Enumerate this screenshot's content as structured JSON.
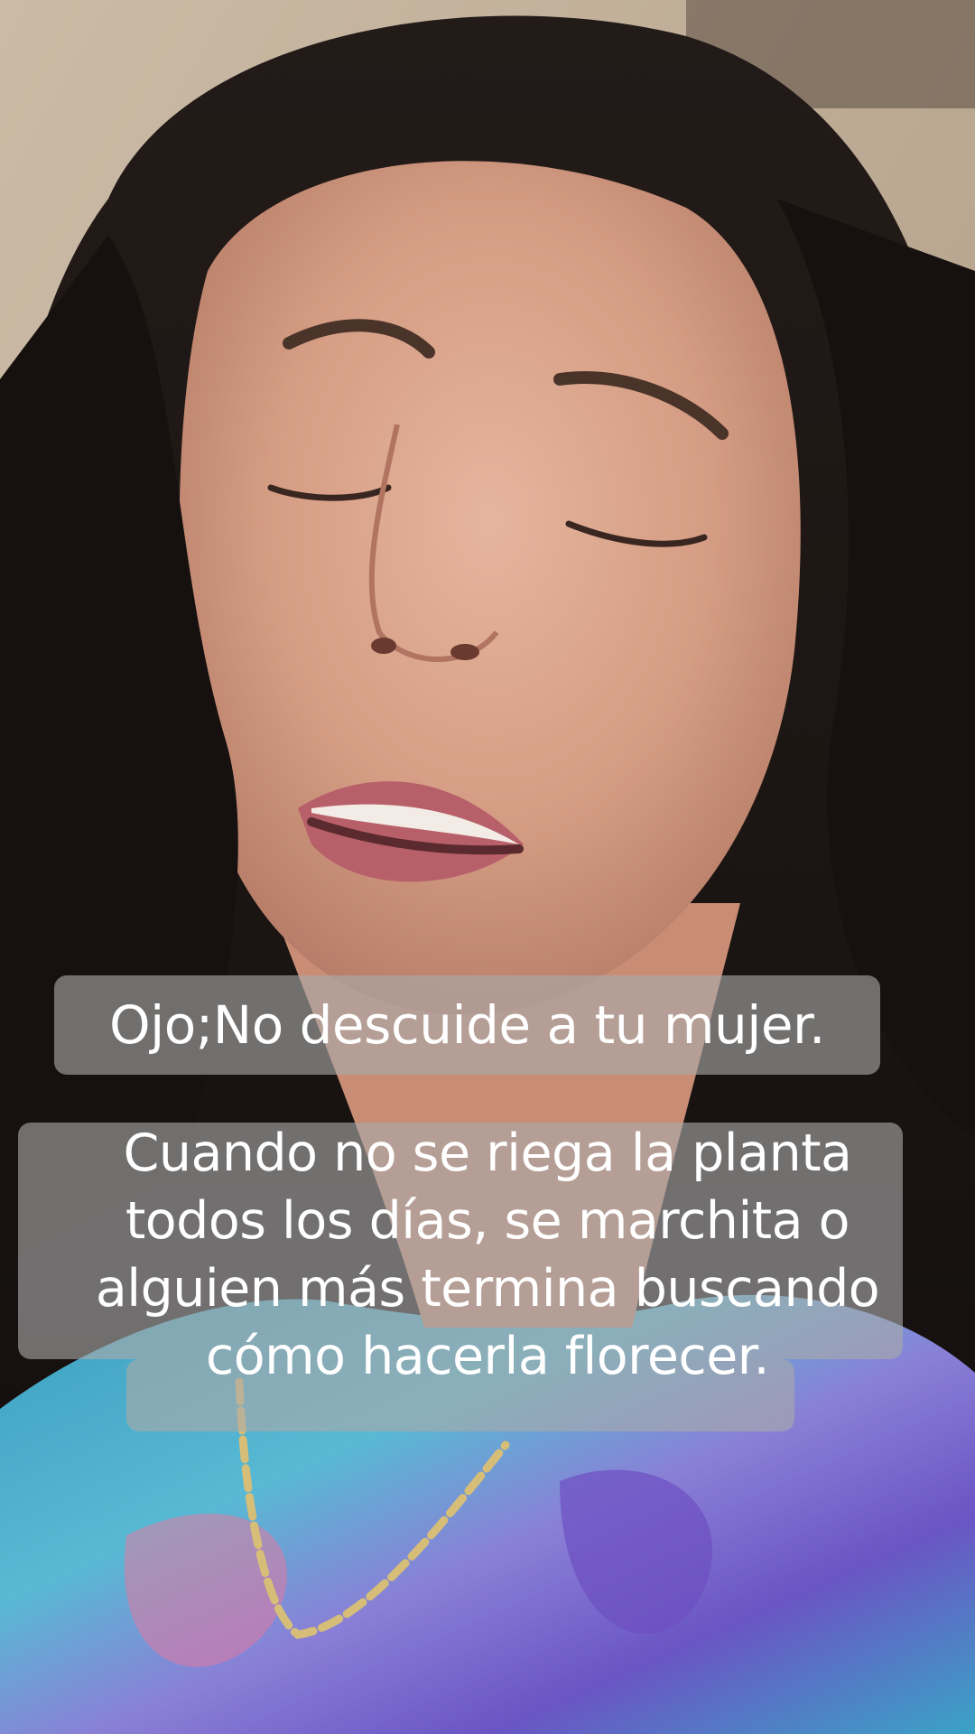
{
  "video": {
    "overlay_captions": [
      "Ojo;No descuide a tu mujer.",
      "Cuando no se riega la planta",
      "todos los días, se marchita o",
      "alguien más termina buscando",
      "cómo hacerla florecer."
    ]
  },
  "colors": {
    "caption_text": "#ffffff",
    "caption_background": "#aaaaaa",
    "wall": "#c9b8a3",
    "hair": "#1c1614",
    "skin": "#d9a58c",
    "shirt_teal": "#3aa6c4",
    "shirt_purple": "#7a5fc9",
    "chain": "#d6bd78"
  }
}
